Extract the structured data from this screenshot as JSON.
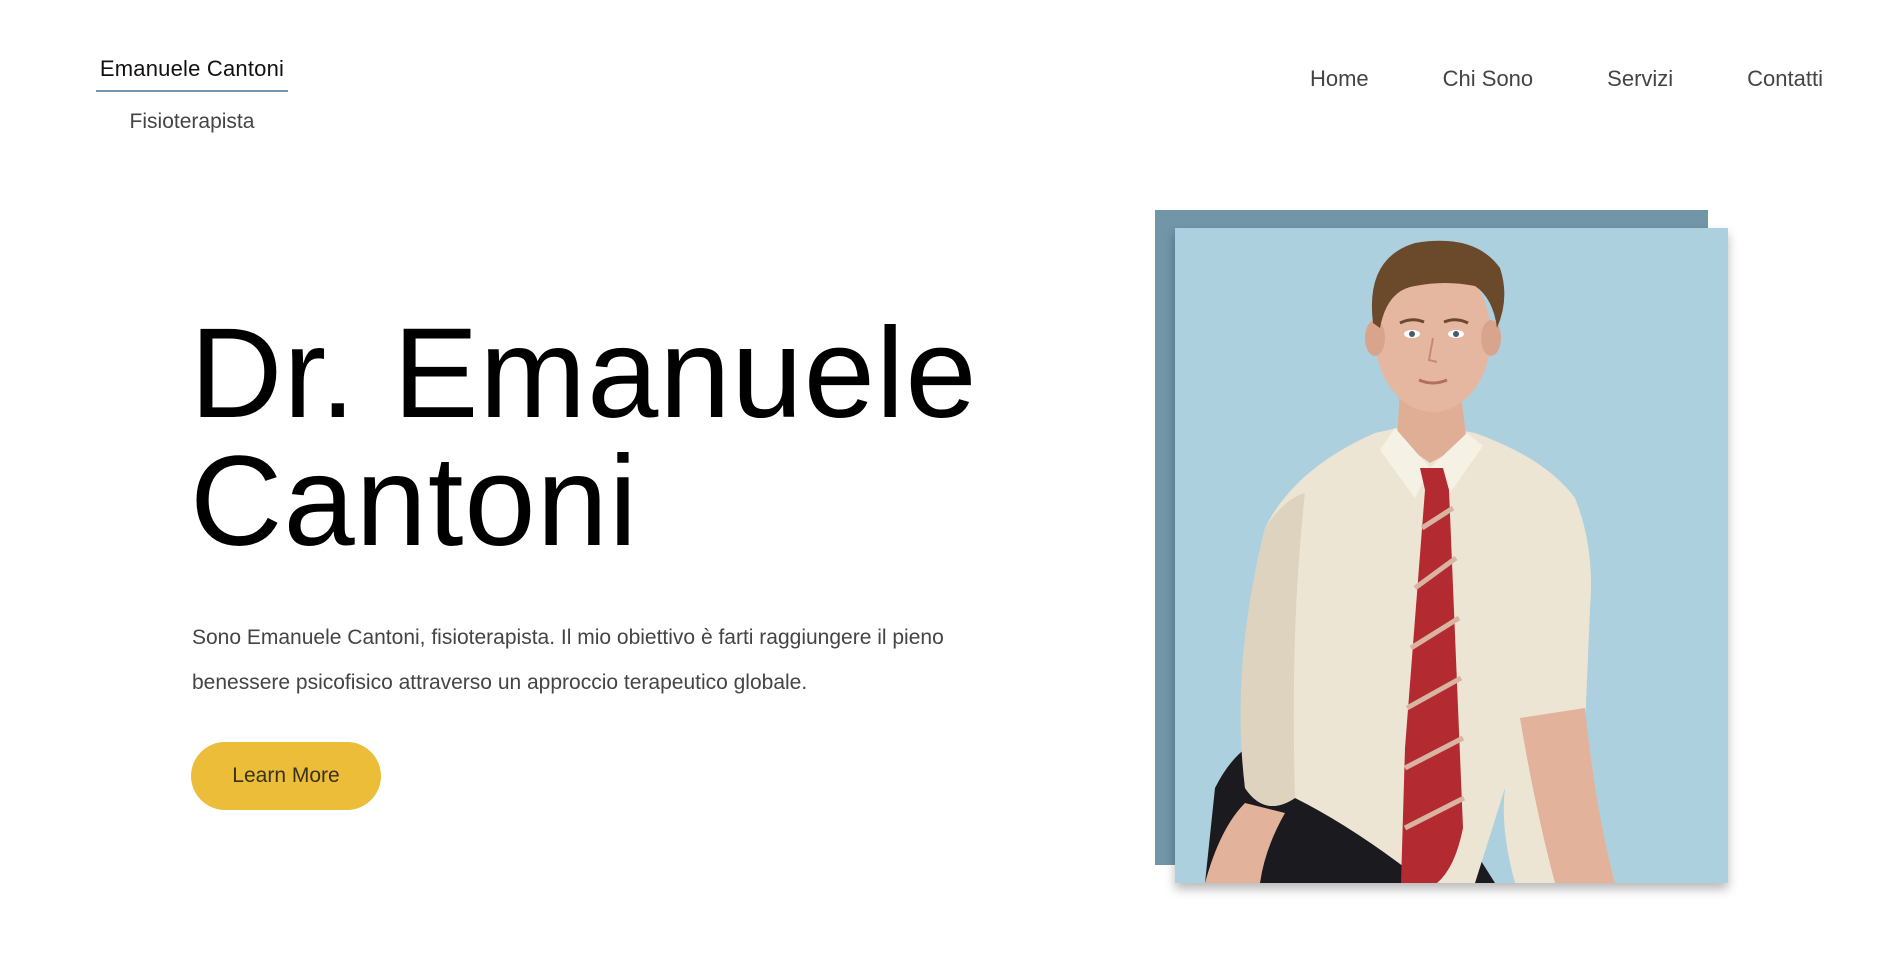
{
  "brand": {
    "name": "Emanuele Cantoni",
    "subtitle": "Fisioterapista"
  },
  "nav": {
    "items": [
      {
        "label": "Home"
      },
      {
        "label": "Chi Sono"
      },
      {
        "label": "Servizi"
      },
      {
        "label": "Contatti"
      }
    ]
  },
  "hero": {
    "title_line1": "Dr. Emanuele",
    "title_line2": "Cantoni",
    "description": "Sono Emanuele Cantoni, fisioterapista. Il mio obiettivo è farti raggiungere il pieno benessere psicofisico attraverso un approccio terapeutico globale.",
    "cta_label": "Learn More"
  },
  "colors": {
    "accent_underline": "#6e98ad",
    "cta_background": "#ebbd39",
    "photo_frame_back": "#7196a8",
    "photo_background": "#add0df"
  }
}
